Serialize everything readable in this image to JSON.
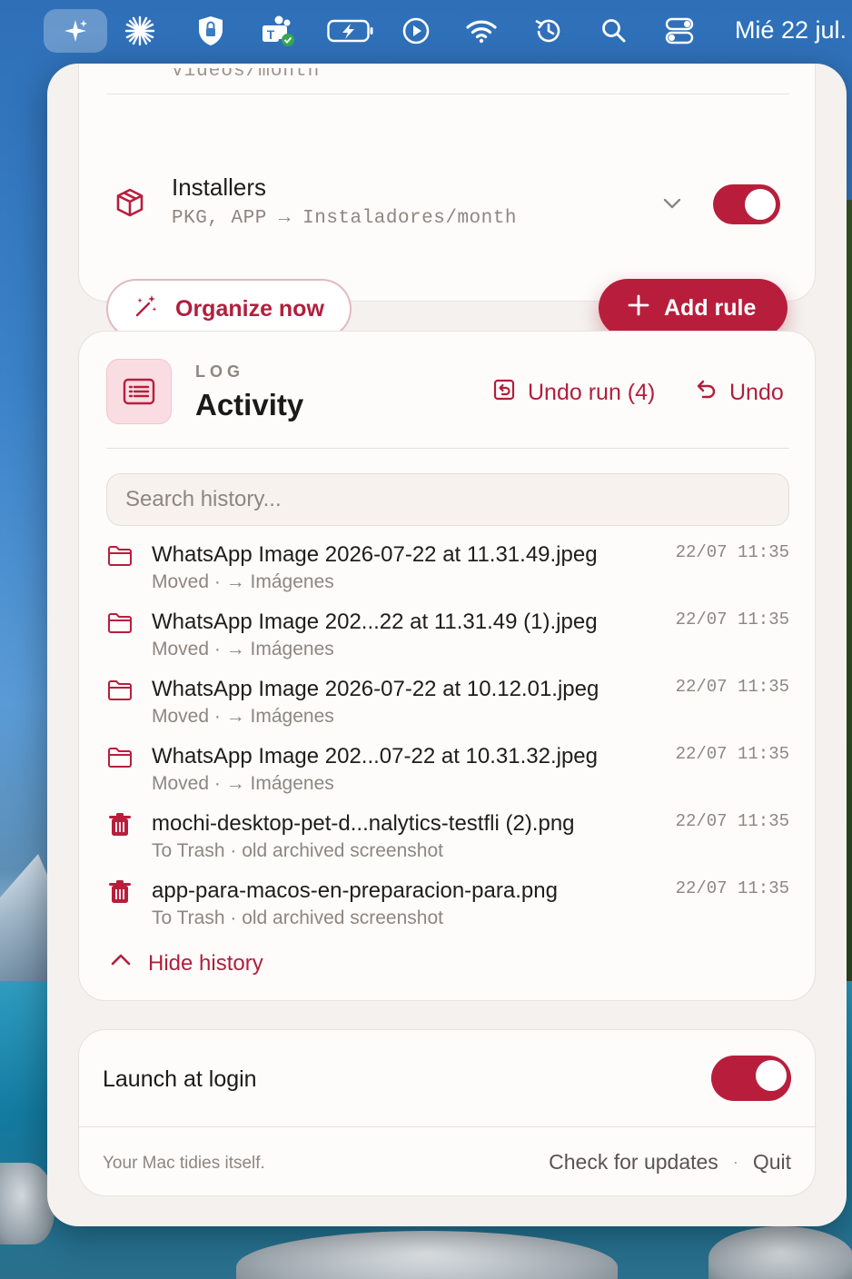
{
  "menubar": {
    "date": "Mié 22 jul."
  },
  "rules": {
    "previous_rule_sub": "Vídeos/month",
    "installers": {
      "name": "Installers",
      "sub": "PKG, APP → Instaladores/month",
      "enabled": true
    },
    "organize_label": "Organize now",
    "add_rule_label": "Add rule"
  },
  "activity": {
    "eyebrow": "LOG",
    "title": "Activity",
    "undo_run_label": "Undo run (4)",
    "undo_label": "Undo",
    "search_placeholder": "Search history...",
    "items": [
      {
        "icon": "folder-icon",
        "name": "WhatsApp Image 2026-07-22 at 11.31.49.jpeg",
        "detail": "Moved · → Imágenes",
        "time": "22/07 11:35"
      },
      {
        "icon": "folder-icon",
        "name": "WhatsApp Image 202...22 at 11.31.49 (1).jpeg",
        "detail": "Moved · → Imágenes",
        "time": "22/07 11:35"
      },
      {
        "icon": "folder-icon",
        "name": "WhatsApp Image 2026-07-22 at 10.12.01.jpeg",
        "detail": "Moved · → Imágenes",
        "time": "22/07 11:35"
      },
      {
        "icon": "folder-icon",
        "name": "WhatsApp Image 202...07-22 at 10.31.32.jpeg",
        "detail": "Moved · → Imágenes",
        "time": "22/07 11:35"
      },
      {
        "icon": "trash-icon",
        "name": "mochi-desktop-pet-d...nalytics-testfli (2).png",
        "detail": "To Trash · old archived screenshot",
        "time": "22/07 11:35"
      },
      {
        "icon": "trash-icon",
        "name": "app-para-macos-en-preparacion-para.png",
        "detail": "To Trash · old archived screenshot",
        "time": "22/07 11:35"
      }
    ],
    "hide_history_label": "Hide history"
  },
  "settings": {
    "launch_at_login_label": "Launch at login",
    "launch_at_login": true,
    "tagline": "Your Mac tidies itself.",
    "check_updates_label": "Check for updates",
    "separator": "·",
    "quit_label": "Quit"
  },
  "colors": {
    "accent": "#b81e3c",
    "accent_text": "#b01f3c",
    "panel_bg": "#f4f1ee",
    "card_bg": "#fdfcfb"
  }
}
